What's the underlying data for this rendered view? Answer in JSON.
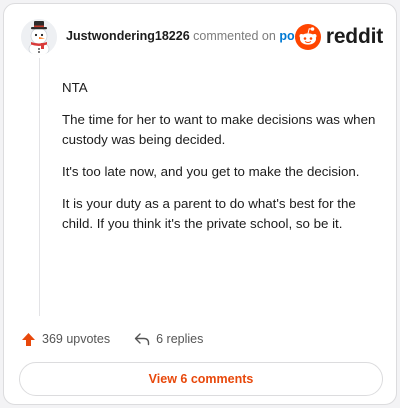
{
  "header": {
    "username": "Justwondering18226",
    "verb": "commented on",
    "post_link": "post",
    "brand": "reddit",
    "avatar_icon": "snowman-avatar-icon",
    "brand_icon": "reddit-snoo-icon"
  },
  "comment": {
    "paragraphs": [
      "NTA",
      "The time for her to want to make decisions was when custody was being decided.",
      "It's too late now, and you get to make the decision.",
      "It is your duty as a parent to do what's best for the child. If you think it's the private school, so be it."
    ]
  },
  "actions": {
    "upvotes": "369 upvotes",
    "replies": "6 replies",
    "upvote_icon": "upvote-arrow-icon",
    "reply_icon": "reply-arrow-icon"
  },
  "footer": {
    "view_comments": "View 6 comments"
  },
  "colors": {
    "accent": "#e8480b",
    "link": "#0079d3",
    "reddit_orange": "#ff4500"
  }
}
